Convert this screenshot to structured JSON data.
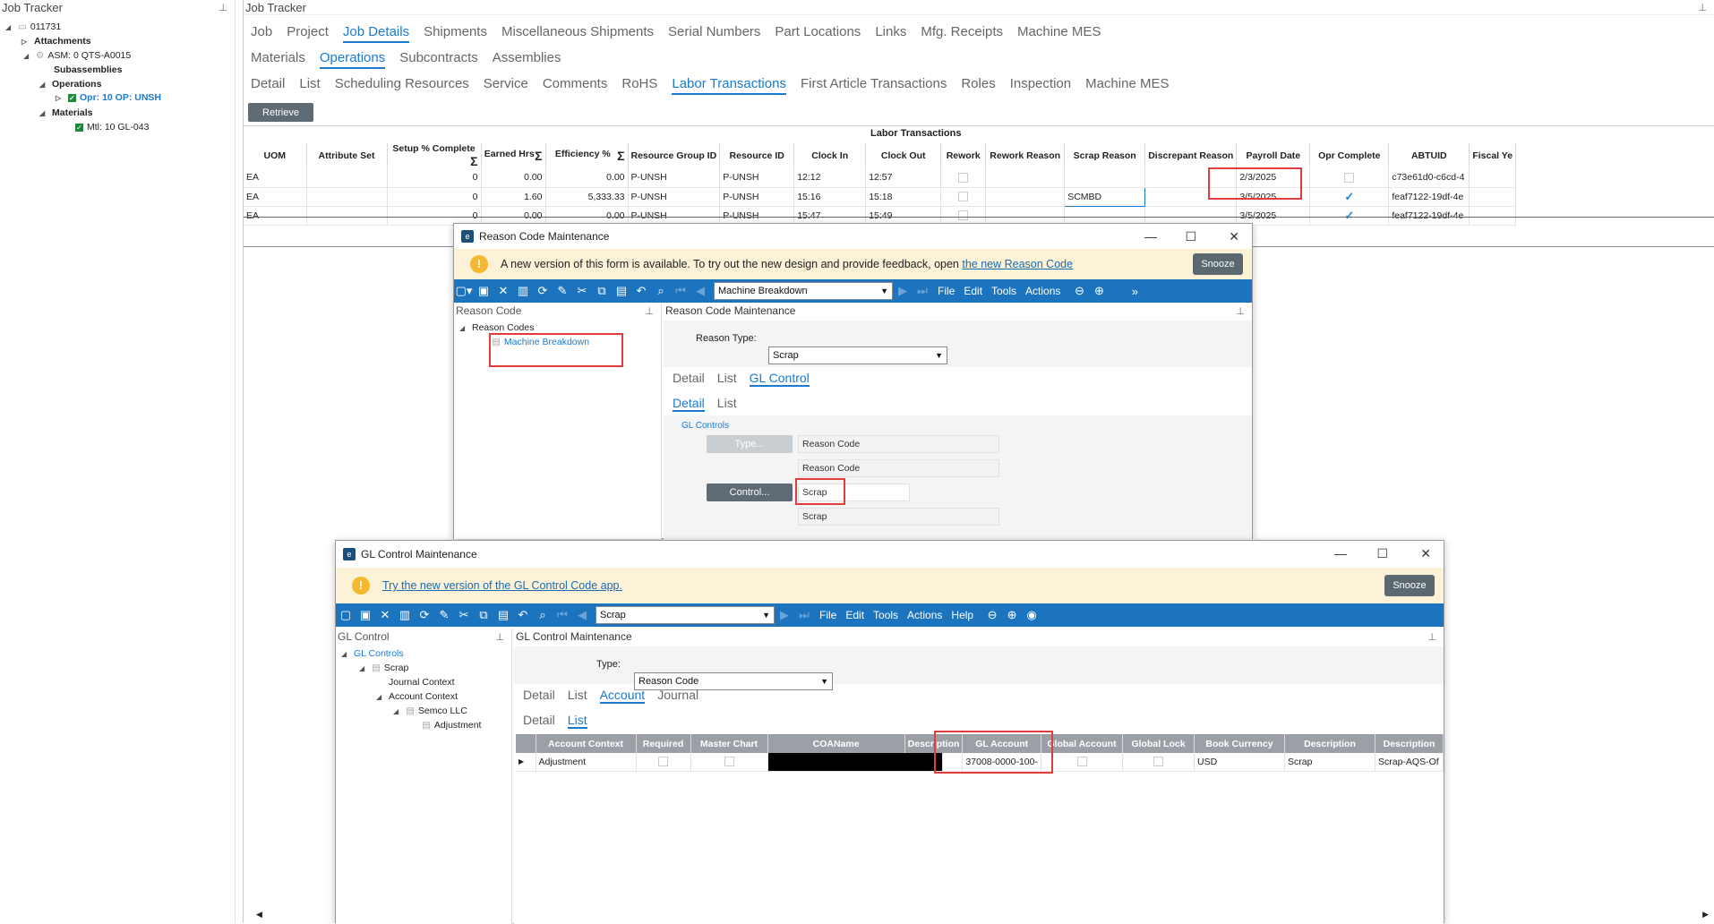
{
  "left_panel": {
    "title": "Job Tracker",
    "tree": {
      "job": "011731",
      "attachments": "Attachments",
      "asm": "ASM: 0 QTS-A0015",
      "subassemblies": "Subassemblies",
      "operations": "Operations",
      "opr": "Opr: 10 OP: UNSH",
      "materials": "Materials",
      "mtl": "Mtl: 10 GL-043"
    }
  },
  "main": {
    "title": "Job Tracker",
    "tabs1": [
      "Job",
      "Project",
      "Job Details",
      "Shipments",
      "Miscellaneous Shipments",
      "Serial Numbers",
      "Part Locations",
      "Links",
      "Mfg. Receipts",
      "Machine MES"
    ],
    "tabs2": [
      "Materials",
      "Operations",
      "Subcontracts",
      "Assemblies"
    ],
    "tabs3": [
      "Detail",
      "List",
      "Scheduling Resources",
      "Service",
      "Comments",
      "RoHS",
      "Labor Transactions",
      "First Article Transactions",
      "Roles",
      "Inspection",
      "Machine MES"
    ],
    "retrieve": "Retrieve",
    "grid_title": "Labor Transactions",
    "sum_symbol": "Σ",
    "columns": [
      "UOM",
      "Attribute Set",
      "Setup % Complete",
      "Earned Hrs",
      "Efficiency %",
      "Resource Group ID",
      "Resource ID",
      "Clock In",
      "Clock Out",
      "Rework",
      "Rework Reason",
      "Scrap Reason",
      "Discrepant Reason",
      "Payroll Date",
      "Opr Complete",
      "ABTUID",
      "Fiscal Ye"
    ],
    "rows": [
      {
        "uom": "EA",
        "setup": "0",
        "earned": "0.00",
        "eff": "0.00",
        "rgid": "P-UNSH",
        "rid": "P-UNSH",
        "in": "12:12",
        "out": "12:57",
        "scrap": "",
        "payroll": "2/3/2025",
        "complete": false,
        "abtuid": "c73e61d0-c6cd-4"
      },
      {
        "uom": "EA",
        "setup": "0",
        "earned": "1.60",
        "eff": "5,333.33",
        "rgid": "P-UNSH",
        "rid": "P-UNSH",
        "in": "15:16",
        "out": "15:18",
        "scrap": "SCMBD",
        "payroll": "3/5/2025",
        "complete": true,
        "abtuid": "feaf7122-19df-4e"
      },
      {
        "uom": "EA",
        "setup": "0",
        "earned": "0.00",
        "eff": "0.00",
        "rgid": "P-UNSH",
        "rid": "P-UNSH",
        "in": "15:47",
        "out": "15:49",
        "scrap": "",
        "payroll": "3/5/2025",
        "complete": true,
        "abtuid": "feaf7122-19df-4e"
      }
    ]
  },
  "reason_window": {
    "title": "Reason Code Maintenance",
    "banner_text": "A new version of this form is available. To try out the new design and provide feedback, open",
    "banner_link": "the new Reason Code",
    "snooze": "Snooze",
    "combo": "Machine Breakdown",
    "menus": [
      "File",
      "Edit",
      "Tools",
      "Actions"
    ],
    "tree_title": "Reason Code",
    "tree_root": "Reason Codes",
    "tree_item": "Machine Breakdown",
    "panel_title": "Reason Code Maintenance",
    "reason_type_label": "Reason Type:",
    "reason_type": "Scrap",
    "tabs": [
      "Detail",
      "List",
      "GL Control"
    ],
    "subtabs": [
      "Detail",
      "List"
    ],
    "group": "GL Controls",
    "type_btn": "Type...",
    "type_val": "Reason Code",
    "type_desc": "Reason Code",
    "control_btn": "Control...",
    "control_val": "Scrap",
    "control_desc": "Scrap"
  },
  "gl_window": {
    "title": "GL Control Maintenance",
    "banner_link": "Try the new version of the GL Control Code app.",
    "snooze": "Snooze",
    "combo": "Scrap",
    "menus": [
      "File",
      "Edit",
      "Tools",
      "Actions",
      "Help"
    ],
    "tree_title": "GL Control",
    "tree": {
      "root": "GL Controls",
      "scrap": "Scrap",
      "journal": "Journal Context",
      "account": "Account Context",
      "company": "Semco LLC",
      "adjustment": "Adjustment"
    },
    "panel_title": "GL Control Maintenance",
    "type_label": "Type:",
    "type_val": "Reason Code",
    "tabs": [
      "Detail",
      "List",
      "Account",
      "Journal"
    ],
    "subtabs": [
      "Detail",
      "List"
    ],
    "columns": [
      "Account Context",
      "Required",
      "Master Chart",
      "COAName",
      "Description",
      "GL Account",
      "Global Account",
      "Global Lock",
      "Book Currency",
      "Description",
      "Description"
    ],
    "row": {
      "context": "Adjustment",
      "gl_account": "37008-0000-100-",
      "currency": "USD",
      "desc1": "Scrap",
      "desc2": "Scrap-AQS-Of"
    }
  },
  "colors": {
    "accent": "#1a7ad0",
    "toolbar": "#1c74be",
    "highlight": "#e03c3c"
  }
}
